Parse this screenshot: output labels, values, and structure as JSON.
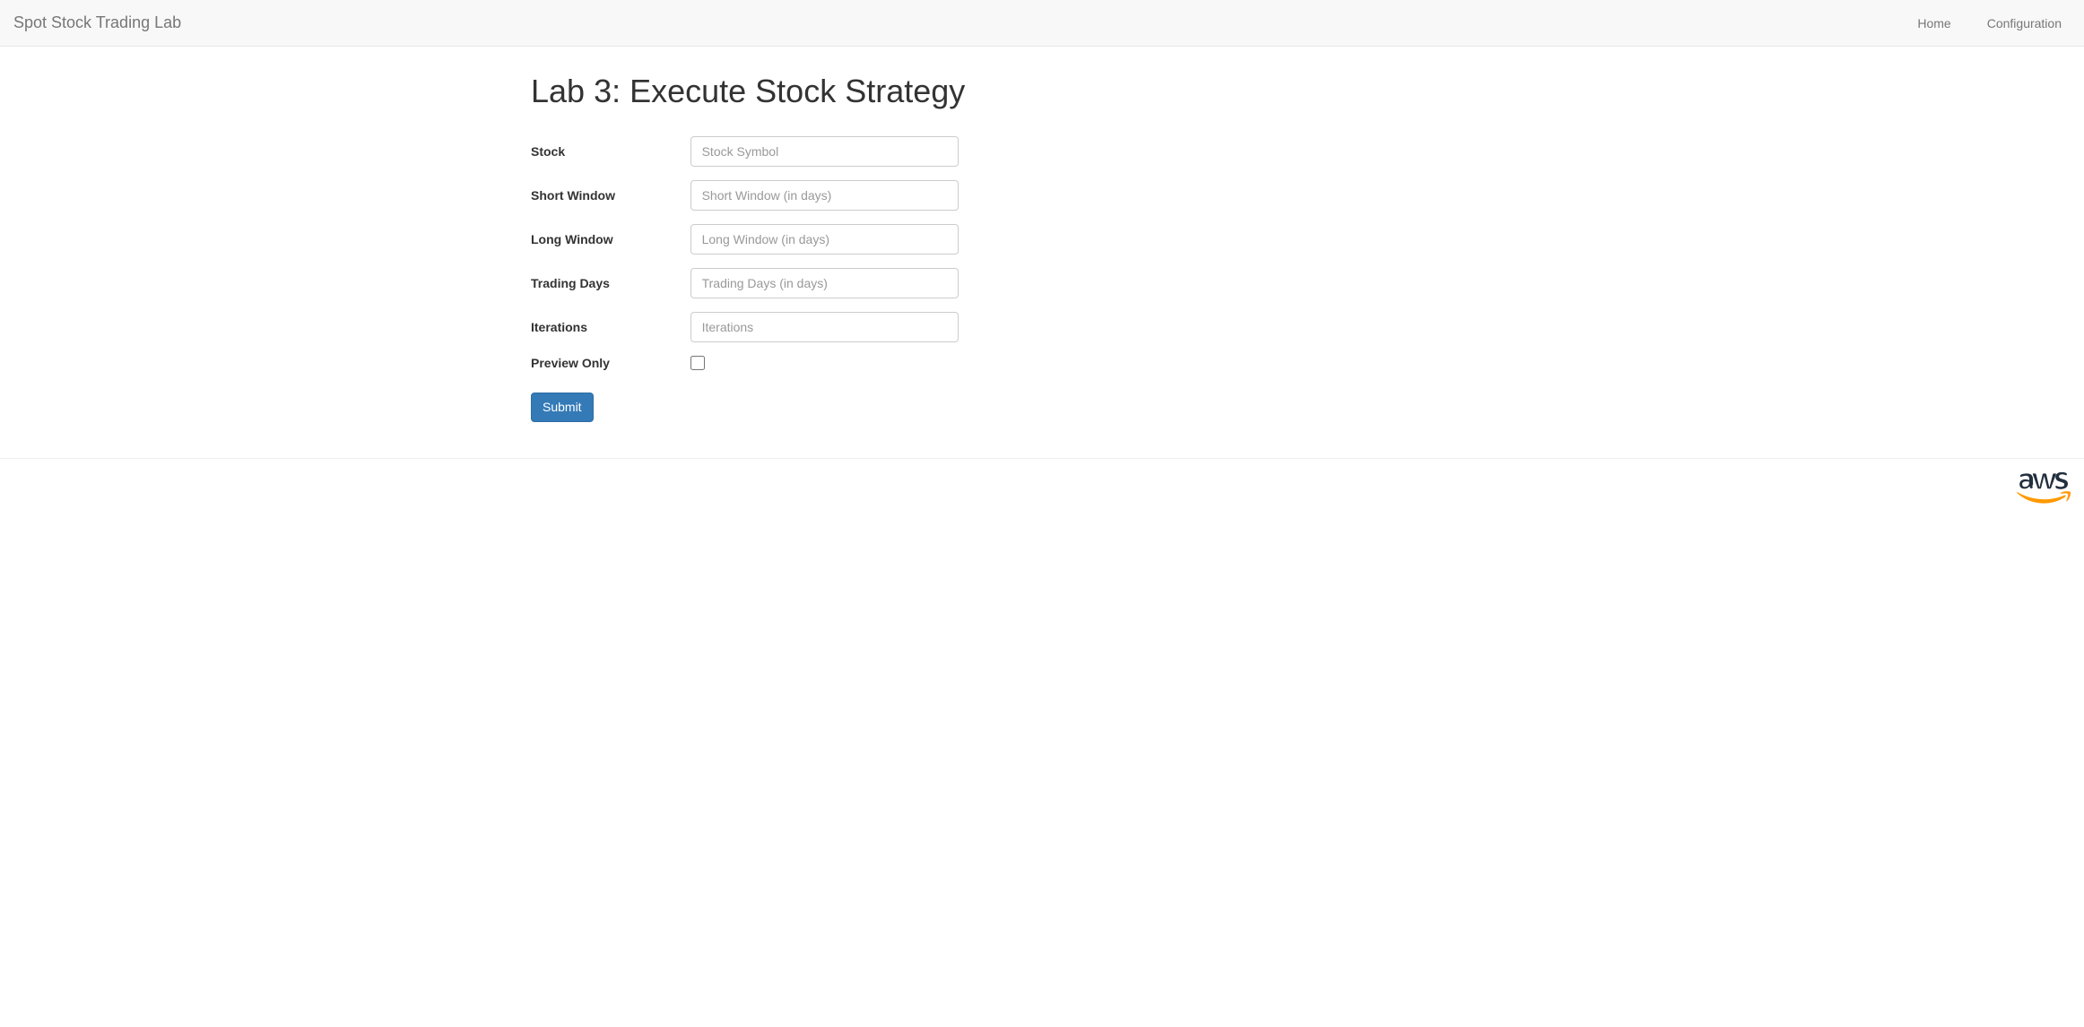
{
  "navbar": {
    "brand": "Spot Stock Trading Lab",
    "links": [
      {
        "label": "Home"
      },
      {
        "label": "Configuration"
      }
    ]
  },
  "page": {
    "title": "Lab 3: Execute Stock Strategy"
  },
  "form": {
    "stock": {
      "label": "Stock",
      "placeholder": "Stock Symbol",
      "value": ""
    },
    "short_window": {
      "label": "Short Window",
      "placeholder": "Short Window (in days)",
      "value": ""
    },
    "long_window": {
      "label": "Long Window",
      "placeholder": "Long Window (in days)",
      "value": ""
    },
    "trading_days": {
      "label": "Trading Days",
      "placeholder": "Trading Days (in days)",
      "value": ""
    },
    "iterations": {
      "label": "Iterations",
      "placeholder": "Iterations",
      "value": ""
    },
    "preview_only": {
      "label": "Preview Only",
      "checked": false
    },
    "submit_label": "Submit"
  },
  "footer": {
    "logo_name": "aws"
  }
}
